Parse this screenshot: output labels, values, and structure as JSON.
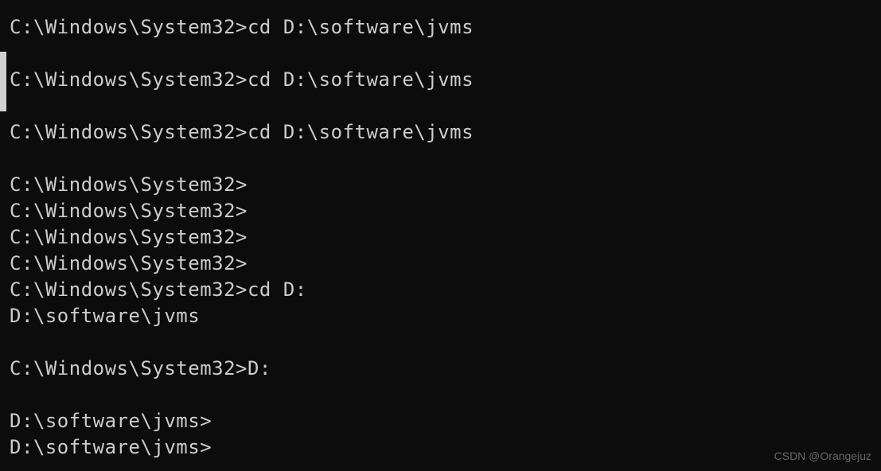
{
  "lines": [
    {
      "text": "C:\\Windows\\System32>cd D:\\software\\jvms",
      "spaced": true
    },
    {
      "text": "C:\\Windows\\System32>cd D:\\software\\jvms",
      "spaced": true
    },
    {
      "text": "C:\\Windows\\System32>cd D:\\software\\jvms",
      "spaced": true
    },
    {
      "text": "C:\\Windows\\System32>",
      "spaced": false
    },
    {
      "text": "C:\\Windows\\System32>",
      "spaced": false
    },
    {
      "text": "C:\\Windows\\System32>",
      "spaced": false
    },
    {
      "text": "C:\\Windows\\System32>",
      "spaced": false
    },
    {
      "text": "C:\\Windows\\System32>cd D:",
      "spaced": false
    },
    {
      "text": "D:\\software\\jvms",
      "spaced": true
    },
    {
      "text": "C:\\Windows\\System32>D:",
      "spaced": true
    },
    {
      "text": "D:\\software\\jvms>",
      "spaced": false
    },
    {
      "text": "D:\\software\\jvms>",
      "spaced": false
    }
  ],
  "watermark": "CSDN @Orangejuz"
}
